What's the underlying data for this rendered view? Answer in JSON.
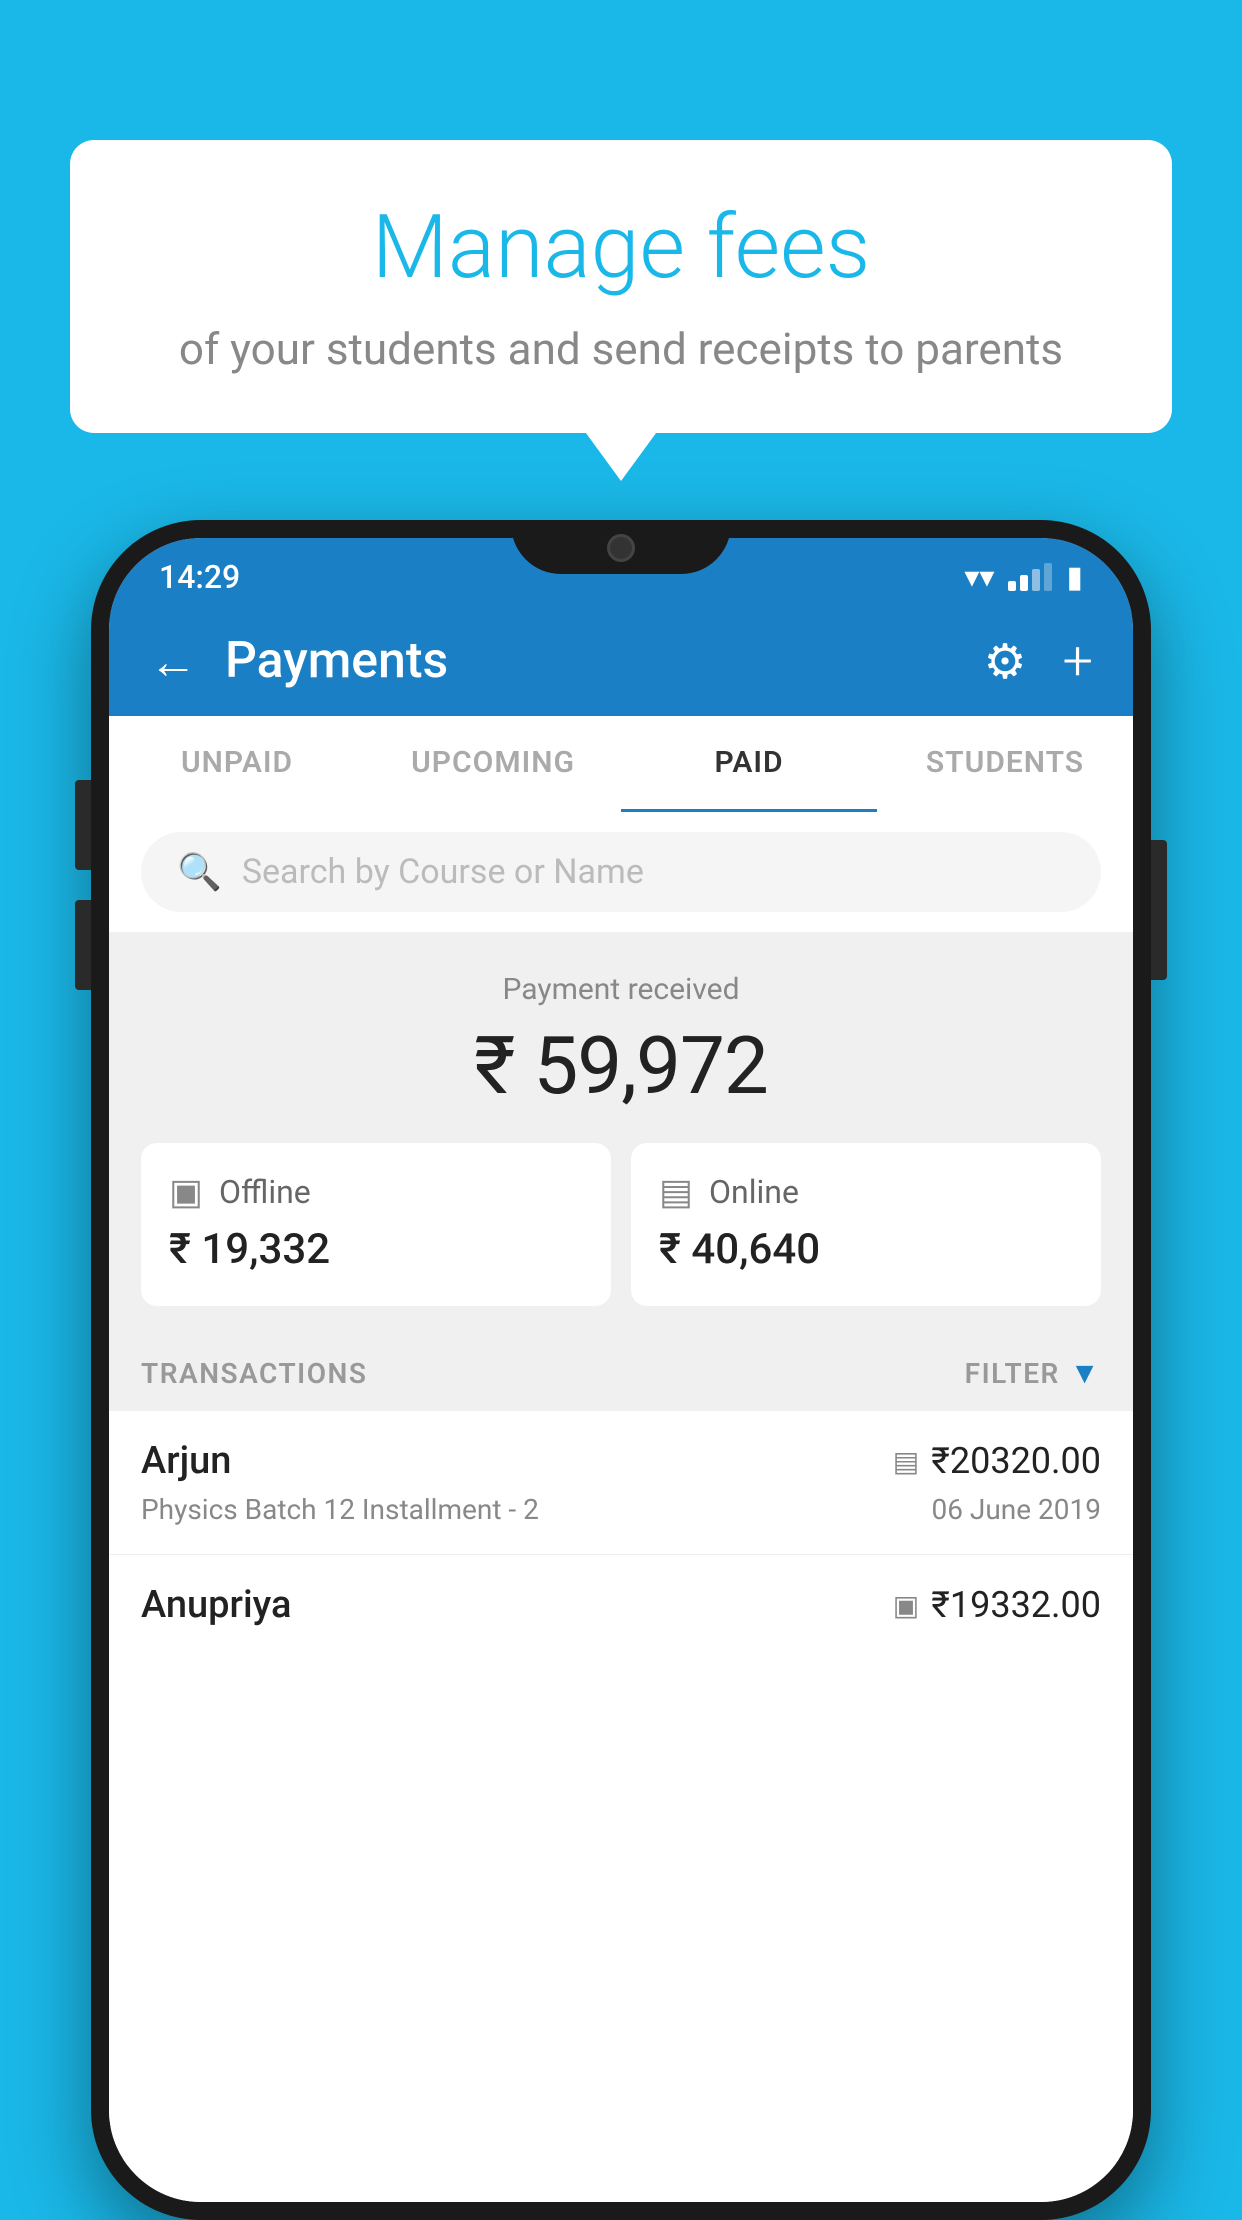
{
  "page": {
    "background_color": "#1ab8e8"
  },
  "speech_bubble": {
    "title": "Manage fees",
    "subtitle": "of your students and send receipts to parents"
  },
  "status_bar": {
    "time": "14:29"
  },
  "header": {
    "title": "Payments",
    "back_label": "←",
    "plus_label": "+"
  },
  "tabs": [
    {
      "label": "UNPAID",
      "active": false
    },
    {
      "label": "UPCOMING",
      "active": false
    },
    {
      "label": "PAID",
      "active": true
    },
    {
      "label": "STUDENTS",
      "active": false
    }
  ],
  "search": {
    "placeholder": "Search by Course or Name"
  },
  "payment_summary": {
    "received_label": "Payment received",
    "total_amount": "₹ 59,972",
    "offline_label": "Offline",
    "offline_amount": "₹ 19,332",
    "online_label": "Online",
    "online_amount": "₹ 40,640"
  },
  "transactions_section": {
    "label": "TRANSACTIONS",
    "filter_label": "FILTER"
  },
  "transactions": [
    {
      "name": "Arjun",
      "course": "Physics Batch 12 Installment - 2",
      "amount": "₹20320.00",
      "date": "06 June 2019",
      "payment_type": "card"
    },
    {
      "name": "Anupriya",
      "course": "",
      "amount": "₹19332.00",
      "date": "",
      "payment_type": "cash"
    }
  ]
}
